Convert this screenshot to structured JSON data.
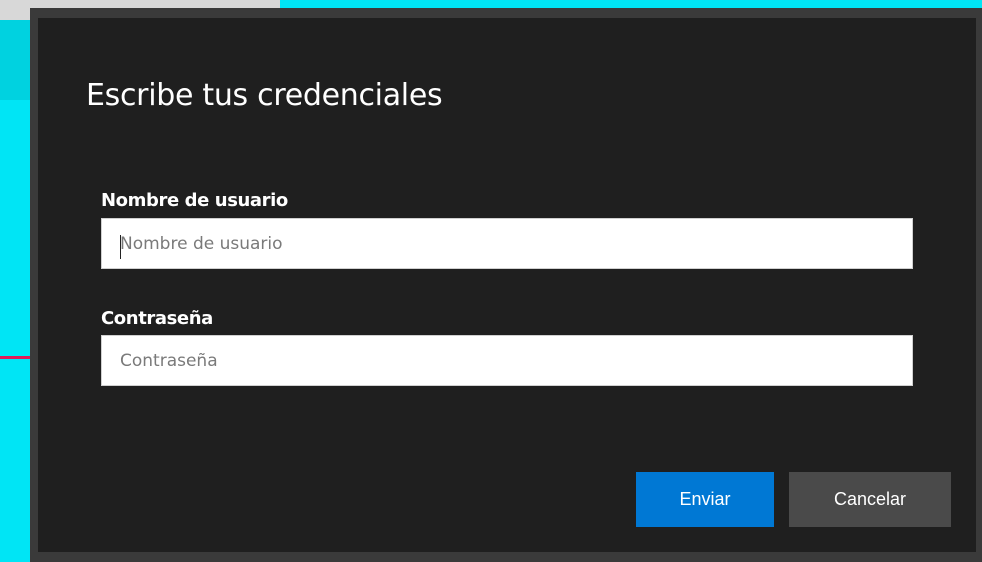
{
  "dialog": {
    "title": "Escribe tus credenciales",
    "username": {
      "label": "Nombre de usuario",
      "placeholder": "Nombre de usuario",
      "value": ""
    },
    "password": {
      "label": "Contraseña",
      "placeholder": "Contraseña",
      "value": ""
    },
    "buttons": {
      "submit_label": "Enviar",
      "cancel_label": "Cancelar"
    }
  },
  "colors": {
    "background_accent": "#00e5f5",
    "dialog_frame": "#3a3a3a",
    "dialog_body": "#1f1f1f",
    "primary_button": "#0078d4",
    "secondary_button": "#4a4a4a",
    "accent_mark": "#e0195a"
  }
}
